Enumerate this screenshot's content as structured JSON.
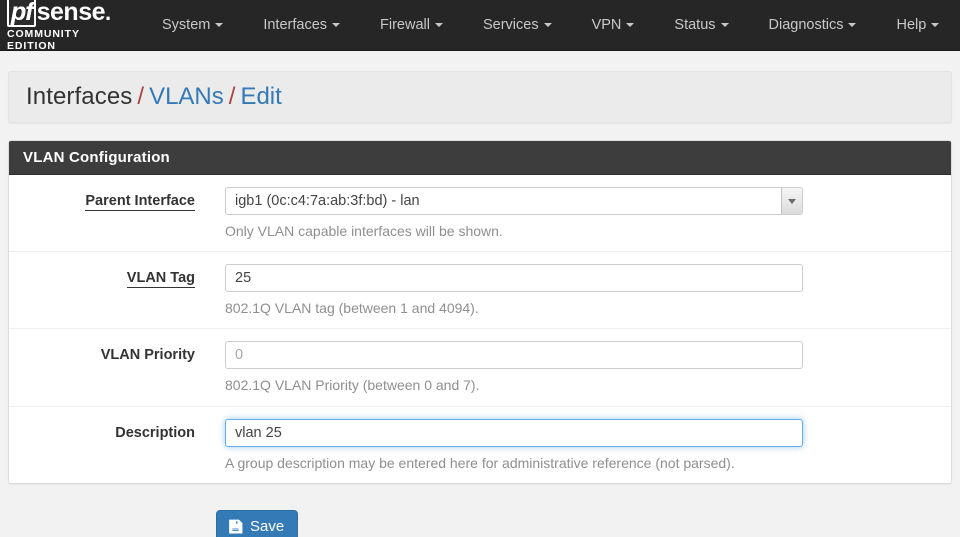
{
  "navbar": {
    "brand": {
      "pf": "pf",
      "sense": "sense",
      "dot": ".",
      "subtitle": "COMMUNITY EDITION"
    },
    "items": [
      {
        "label": "System",
        "icon": "chevron-down-icon"
      },
      {
        "label": "Interfaces",
        "icon": "chevron-down-icon"
      },
      {
        "label": "Firewall",
        "icon": "chevron-down-icon"
      },
      {
        "label": "Services",
        "icon": "chevron-down-icon"
      },
      {
        "label": "VPN",
        "icon": "chevron-down-icon"
      },
      {
        "label": "Status",
        "icon": "chevron-down-icon"
      },
      {
        "label": "Diagnostics",
        "icon": "chevron-down-icon"
      },
      {
        "label": "Help",
        "icon": "chevron-down-icon"
      }
    ]
  },
  "breadcrumb": {
    "root": "Interfaces",
    "sep1": "/",
    "link1": "VLANs",
    "sep2": "/",
    "link2": "Edit"
  },
  "panel": {
    "title": "VLAN Configuration",
    "rows": {
      "parent_interface": {
        "label": "Parent Interface",
        "value": "igb1 (0c:c4:7a:ab:3f:bd) - lan",
        "help": "Only VLAN capable interfaces will be shown.",
        "options": [
          "igb1 (0c:c4:7a:ab:3f:bd) - lan"
        ]
      },
      "vlan_tag": {
        "label": "VLAN Tag",
        "value": "25",
        "placeholder": "",
        "help": "802.1Q VLAN tag (between 1 and 4094)."
      },
      "vlan_priority": {
        "label": "VLAN Priority",
        "value": "",
        "placeholder": "0",
        "help": "802.1Q VLAN Priority (between 0 and 7)."
      },
      "description": {
        "label": "Description",
        "value": "vlan 25",
        "placeholder": "",
        "help": "A group description may be entered here for administrative reference (not parsed)."
      }
    }
  },
  "actions": {
    "save_label": "Save",
    "save_icon": "floppy-disk-save-icon"
  },
  "colors": {
    "navbar_bg": "#262626",
    "panel_header_bg": "#3d3d3d",
    "link_blue": "#337ab7",
    "separator_red": "#a94442",
    "focus_blue": "#66afe9",
    "page_bg": "#f2f2f2"
  }
}
